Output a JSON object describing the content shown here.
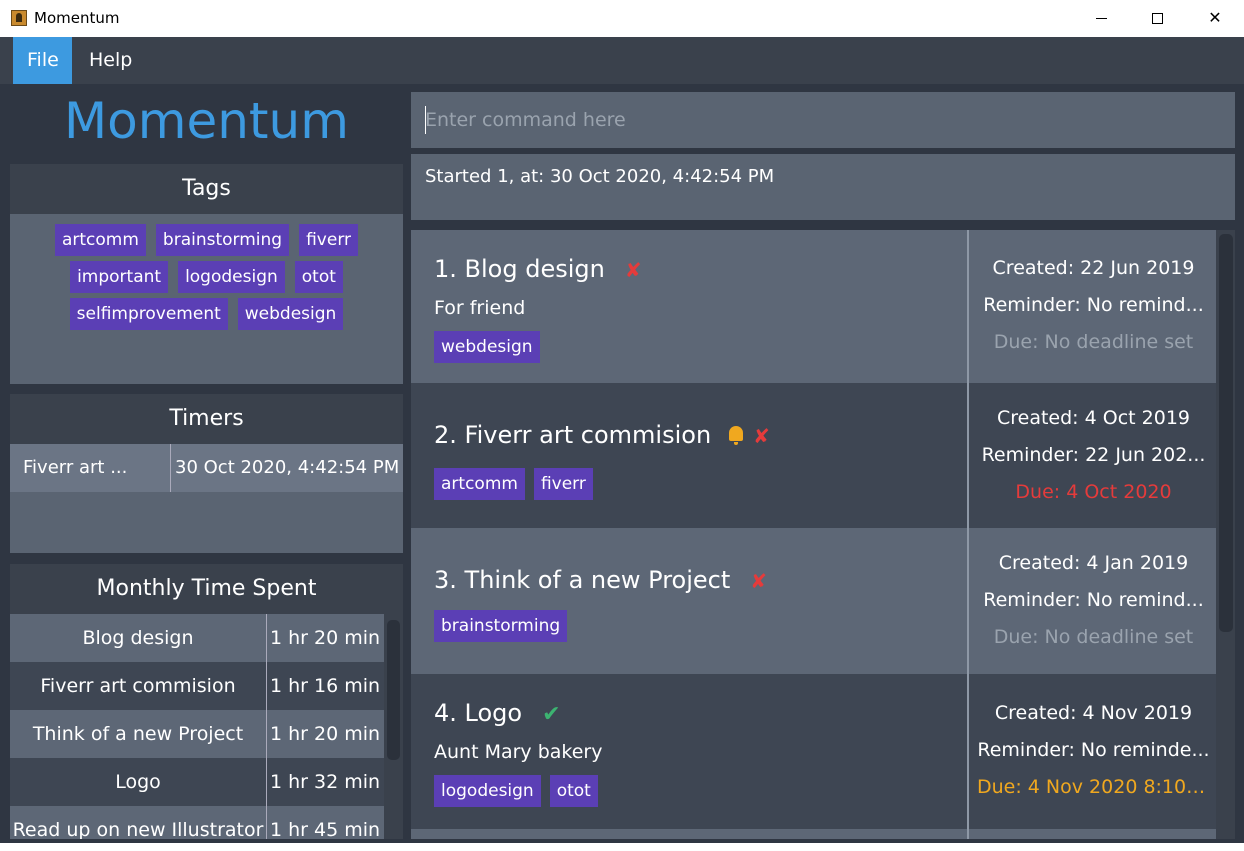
{
  "window": {
    "title": "Momentum"
  },
  "menu": {
    "file": "File",
    "help": "Help"
  },
  "app": {
    "logo": "Momentum"
  },
  "tags_panel": {
    "title": "Tags",
    "tags": [
      "artcomm",
      "brainstorming",
      "fiverr",
      "important",
      "logodesign",
      "otot",
      "selfimprovement",
      "webdesign"
    ]
  },
  "timers_panel": {
    "title": "Timers",
    "rows": [
      {
        "name": "Fiverr art ...",
        "time": "30 Oct 2020, 4:42:54 PM"
      }
    ]
  },
  "monthly_panel": {
    "title": "Monthly Time Spent",
    "rows": [
      {
        "name": "Blog design",
        "time": "1 hr 20 min"
      },
      {
        "name": "Fiverr art commision",
        "time": "1 hr 16 min"
      },
      {
        "name": "Think of a new Project",
        "time": "1 hr 20 min"
      },
      {
        "name": "Logo",
        "time": "1 hr 32 min"
      },
      {
        "name": "Read up on new Illustrator",
        "time": "1 hr 45 min"
      }
    ]
  },
  "command": {
    "placeholder": "Enter command here",
    "value": ""
  },
  "result": {
    "text": "Started 1, at: 30 Oct 2020, 4:42:54 PM"
  },
  "tasks": [
    {
      "name": "1. Blog design",
      "status": "incomplete",
      "reminder_icon": false,
      "description": "For friend",
      "tags": [
        "webdesign"
      ],
      "created": "Created: 22 Jun 2019",
      "reminder": "Reminder: No remind...",
      "due": "Due: No deadline set",
      "due_color": "#9aa3ae"
    },
    {
      "name": "2. Fiverr art commision",
      "status": "incomplete",
      "reminder_icon": true,
      "description": "",
      "tags": [
        "artcomm",
        "fiverr"
      ],
      "created": "Created: 4 Oct 2019",
      "reminder": "Reminder: 22 Jun 202...",
      "due": "Due: 4 Oct 2020",
      "due_color": "#e53b3b"
    },
    {
      "name": "3. Think of a new Project",
      "status": "incomplete",
      "reminder_icon": false,
      "description": "",
      "tags": [
        "brainstorming"
      ],
      "created": "Created: 4 Jan 2019",
      "reminder": "Reminder: No remind...",
      "due": "Due: No deadline set",
      "due_color": "#9aa3ae"
    },
    {
      "name": "4. Logo",
      "status": "complete",
      "reminder_icon": false,
      "description": "Aunt Mary bakery",
      "tags": [
        "logodesign",
        "otot"
      ],
      "created": "Created: 4 Nov 2019",
      "reminder": "Reminder: No reminde...",
      "due": "Due: 4 Nov 2020 8:10:...",
      "due_color": "#f0a81f"
    }
  ],
  "icons": {
    "incomplete": "cross-icon",
    "complete": "check-icon",
    "reminder": "bell-icon"
  },
  "colors": {
    "accent": "#3d9ae0",
    "tag": "#5b3fb5",
    "overdue": "#e53b3b",
    "upcoming": "#f0a81f",
    "complete": "#3cb371"
  }
}
